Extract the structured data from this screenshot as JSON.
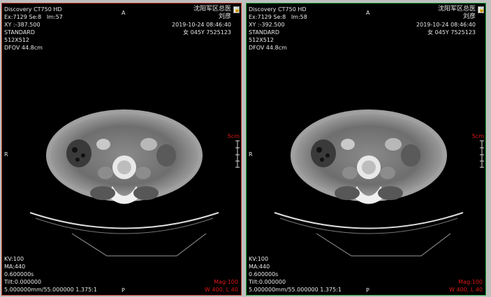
{
  "viewports": [
    {
      "name": "left",
      "device": "Discovery CT750 HD",
      "exam": "Ex:7129  Se:8",
      "image_no": "Im:57",
      "coord": "XY :-387.500",
      "kernel": "STANDARD",
      "matrix": "512X512",
      "dfov": "DFOV 44.8cm",
      "hospital": "沈阳军区总医",
      "patient_name": "刘彦",
      "datetime": "2019-10-24 08:46:40",
      "sex_age_id": "女 045Y  7525123",
      "kv": "KV:100",
      "ma": "MA:440",
      "time": "0.600000s",
      "tilt": "Tilt:0.000000",
      "thickness": "5.000000mm/55.000000  1.375:1",
      "mag": "Mag:100",
      "window": "W 400, L 40",
      "orient_top": "A",
      "orient_left": "R",
      "orient_bottom": "P",
      "scale_label": "5cm"
    },
    {
      "name": "right",
      "device": "Discovery CT750 HD",
      "exam": "Ex:7129  Se:8",
      "image_no": "Im:58",
      "coord": "XY :-392.500",
      "kernel": "STANDARD",
      "matrix": "512X512",
      "dfov": "DFOV 44.8cm",
      "hospital": "沈阳军区总医",
      "patient_name": "刘彦",
      "datetime": "2019-10-24 08:46:40",
      "sex_age_id": "女 045Y  7525123",
      "kv": "KV:100",
      "ma": "MA:440",
      "time": "0.600000s",
      "tilt": "Tilt:0.000000",
      "thickness": "5.000000mm/55.000000  1.375:1",
      "mag": "Mag:100",
      "window": "W 400, L 40",
      "orient_top": "A",
      "orient_left": "R",
      "orient_bottom": "P",
      "scale_label": "5cm"
    }
  ],
  "colors": {
    "left_border": "#c0392b",
    "right_border": "#23a843",
    "overlay_text": "#e8e8e8",
    "overlay_red": "#e01818"
  },
  "icons": {
    "lock": "lock-icon"
  }
}
